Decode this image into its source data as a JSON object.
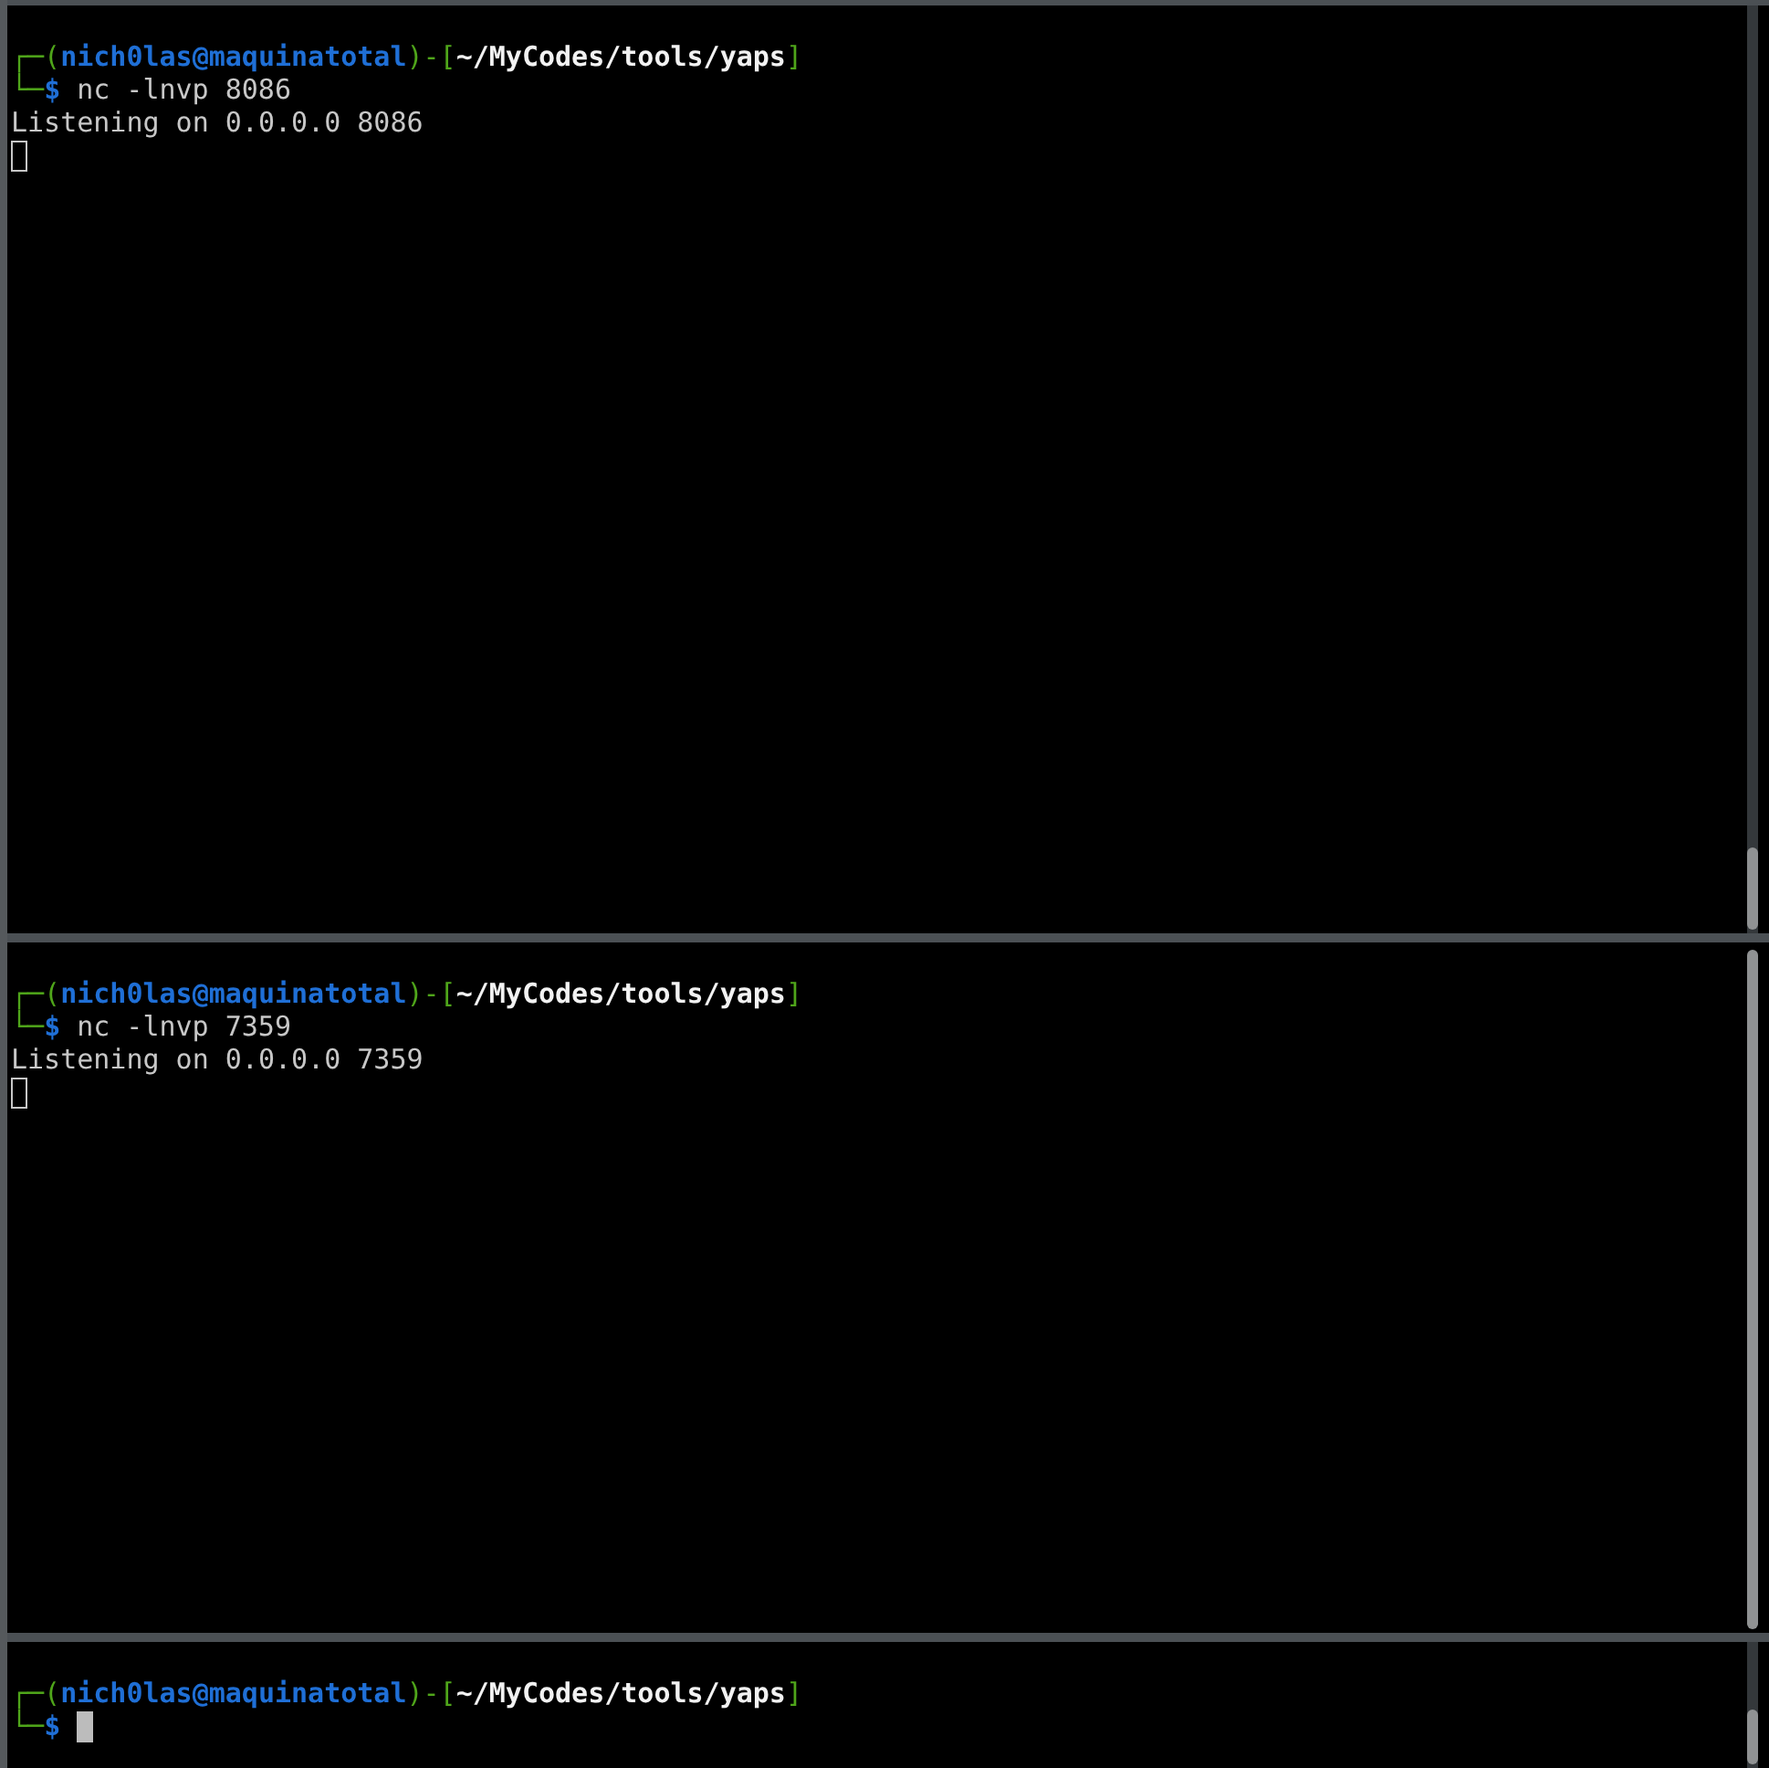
{
  "panes": [
    {
      "prompt": {
        "corner_top": "┌─(",
        "user_host": "nich0las@maquinatotal",
        "separator": ")-[",
        "path": "~/MyCodes/tools/yaps",
        "close": "]",
        "corner_bottom": "└─",
        "symbol": "$"
      },
      "command": "nc -lnvp 8086",
      "output": [
        "Listening on 0.0.0.0 8086"
      ],
      "cursor": {
        "kind": "hollow"
      }
    },
    {
      "prompt": {
        "corner_top": "┌─(",
        "user_host": "nich0las@maquinatotal",
        "separator": ")-[",
        "path": "~/MyCodes/tools/yaps",
        "close": "]",
        "corner_bottom": "└─",
        "symbol": "$"
      },
      "command": "nc -lnvp 7359",
      "output": [
        "Listening on 0.0.0.0 7359"
      ],
      "cursor": {
        "kind": "hollow"
      }
    },
    {
      "prompt": {
        "corner_top": "┌─(",
        "user_host": "nich0las@maquinatotal",
        "separator": ")-[",
        "path": "~/MyCodes/tools/yaps",
        "close": "]",
        "corner_bottom": "└─",
        "symbol": "$"
      },
      "cursor": {
        "kind": "block"
      }
    }
  ]
}
